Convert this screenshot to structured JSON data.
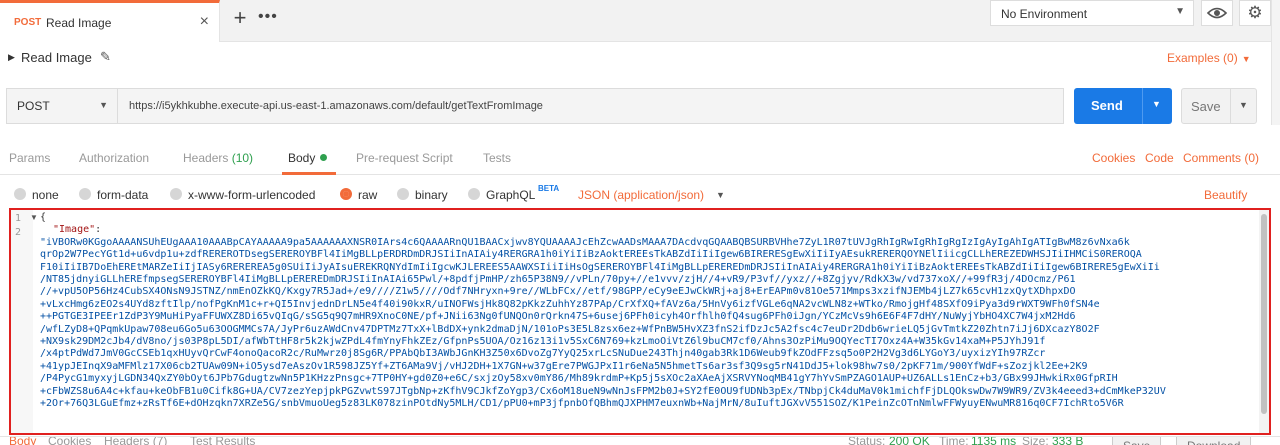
{
  "tabs": {
    "active": {
      "method": "POST",
      "name": "Read Image",
      "close": "×"
    },
    "add": "+",
    "more": "•••"
  },
  "environment": {
    "selected": "No Environment"
  },
  "request": {
    "name": "Read Image",
    "examples_label": "Examples (0)",
    "method": "POST",
    "url": "https://i5ykhkubhe.execute-api.us-east-1.amazonaws.com/default/getTextFromImage",
    "send_label": "Send",
    "save_label": "Save"
  },
  "request_tabs": [
    {
      "label": "Params",
      "count": ""
    },
    {
      "label": "Authorization",
      "count": ""
    },
    {
      "label": "Headers",
      "count": "(10)"
    },
    {
      "label": "Body",
      "count": ""
    },
    {
      "label": "Pre-request Script",
      "count": ""
    },
    {
      "label": "Tests",
      "count": ""
    }
  ],
  "right_links": [
    "Cookies",
    "Code",
    "Comments (0)"
  ],
  "body_types": [
    {
      "label": "none",
      "selected": false
    },
    {
      "label": "form-data",
      "selected": false
    },
    {
      "label": "x-www-form-urlencoded",
      "selected": false
    },
    {
      "label": "raw",
      "selected": true
    },
    {
      "label": "binary",
      "selected": false
    },
    {
      "label": "GraphQL",
      "selected": false
    }
  ],
  "beta_label": "BETA",
  "raw_format": "JSON (application/json)",
  "beautify_label": "Beautify",
  "editor": {
    "line_numbers": [
      "1",
      "2"
    ],
    "open_brace": "{",
    "key": "\"Image\"",
    "colon": ":",
    "value_lines": [
      "\"iVBORw0KGgoAAAANSUhEUgAAA10AAABpCAYAAAAA9pa5AAAAAAXNSR0IArs4c6QAAAARnQU1BAACxjwv8YQUAAAAJcEhZcwAADsMAAA7DAcdvqGQAABQBSURBVHhe7ZyL1R07tUVJgRhIgRwIgRhIgRgIzIgAyIgAhIgATIgBwM8z6vNxa6k",
      "qrOp2W7PecYGt1d+u6vdp1u+zdfREREROTDsegSEREROYBFl4IiMgBLLpERDRDmDRJSIiInAIAiy4RERGRA1h0iYiIiBzAoktEREEsTkABZdIiIiIgew6BIRERESgEwXiIiIyAEsukRERERQOYNElIiicgCLLhEREZEDWHSJIiIHMCiS0REROQA",
      "F10iIiIB7DoEhEREtMARZeIiIjIASy6REREREA5g0SUiIiJyAIsuEREKRQNYdImIiIgcwKJLEREES5AAWXSIiiIiHsOgSEREROYBFl4IiMgBLLpEREREDmDRJSIiInAIAiy4RERGRA1h0iYiIiBzAoktEREEsTkABZdIiIiIgew6BIRERE5gEwXiIi",
      "/NT85jdnyiGLLhEREfmpsegSEREROYBFl4IiMgBLLpEREREDmDRJSIiInAIAi65Pwl/+8pdfjPmHP/zh65P38N9//vPLn/70py+//e1vvv/zjH//4+vR9/P3vf//yxz//+8Zgjyv/RdkX3w/vd737xoX//+99fR3j/4DOcmz/P61",
      "//+vpU5OP56Hz4CubSX4ONsN9JSTNZ/nmEnOZkKQ/Kxgy7R5Jad+/e9////Z1w5////Odf7NHryxn+9re//WLbFCx//etf/98GPP/eCy9eEJwCkWRj+aj8+ErEAPm0v81Oe571Mmps3xzifNJEMb4jLZ7k65cvH1zxQytXDhpxDO",
      "+vLxcHmg6zEO2s4UYd8zftIlp/nofPgKnM1c+r+QI5InvjednDrLN5e4f40i90kxR/uINOFWsjHk8Q82pKkzZuhhYz87PAp/CrXfXQ+fAVz6a/5HnVy6izfVGLe6qNA2vcWLN8z+WTko/RmojgHf48SXfO9iPya3d9rWXT9WFh0fSN4e",
      "++PGTGE3IPEEr1ZdP3Y9MuHiPyaFFUWXZ8Di65vQIqG/sSG5q9Q7mHR9XnoC0NE/pf+JNii63Ng0fUNQOn0rQrkn47S+6usej6PFh0icyh4Orfhlh0fQ4sug6PFh0iJgn/YCzMcVs9h6E6F4F7dHY/NuWyjYbHO4XC7W4jxM2Hd6",
      "/wfLZyD8+QPqmkUpaw708eu6Go5u63OOGMMCs7A/JyPr6uzAWdCnv47DPTMz7TxX+lBdDX+ynk2dmaDjN/101oPs3E5L8zsx6ez+WfPnBW5HvXZ3fnS2ifDzJc5A2fsc4c7euDr2Ddb6wrieLQ5jGvTmtkZ20Zhtn7iJj6DXcazY8O2F",
      "+NX9sk29DM2cJb4/dV8no/js03P8pL5DI/afWbTtHF8r5k2kjwZPdL4fmYnyFhkZEz/GfpnPs5UOA/Oz16z13i1v5SxC6N769+kzLmoOiVtZ6l9buCM7cf0/Ahns3OzPiMu9OQYecTI7Oxz4A+W35kGv14xaM+P5JYhJ91f",
      "/x4ptPdWd7JmV0GcCSEb1qxHUyvQrCwF4onoQacoR2c/RuMwrz0j8Sg6R/PPAbQbI3AWbJGnKH3Z50x6DvoZg7YyQ25xrLcSNuDue243Thjn40gab3Rk1D6Weub9fkZOdFFzsq5o0P2H2Vg3d6LYGoY3/uyxizYIh97RZcr",
      "+41ypJEInqX9aMFMlz17X06cb2TUAw09N+iO5ysd7eAszOv1R598JZ5Yf+ZT6AMa9Vj/vHJ2DH+1X7GN+w37gEre7PWGJPxI1r6eNa5N5hmetTs6ar3sf3Q9sg5rN41DdJ5+lok98hw7s0/2pKF71m/900YfWdF+sZozjkl2Ee+2K9",
      "/P4PycG1myxyjLGDN34QxZY0bOyt6JPb7GdugtzwNn5P1KHzzPnsgc+7TP0HY+gd0Z0+e6C/sxjzOy58xv0mY86/Mh89krdmP+Kp5j5sXOc2aXAeAjXSRVYNoqMB41gY7hYvSmPZAGO1AUP+UZ6ALLs1EnCz+b3/GBx99JHwkiRx0GfpRIH",
      "+cFbWZS8u6A4c+kfau+keObFB1u0Cifk8G+UA/CV7zezYepjpkPGZvwtS97JTgbNp+zKfhV9CJkfZoYgp3/Cx6oM18ueN9wNnJsFPM2b0J+SY2fE0OU9fUDNb3pEx/TNbpjCk4duMaV0k1michfFjDLQOkswDw7W9WR9/ZV3k4eeed3+dCmMkeP32UV",
      "+2Or+76Q3LGuEfmz+zRsTf6E+dOHzqkn7XRZe5G/snbVmuoUeg5z83LK078zinPOtdNy5MLH/CD1/pPU0+mP3jfpnbOfQBhmQJXPHM7euxnWb+NajMrN/8uIuftJGXvV551SOZ/K1PeinZcOTnNmlwFFWyuyENwuMR816q0CF7IchRto5V6R"
    ]
  },
  "response_bar": {
    "tabs": [
      "Body",
      "Cookies",
      "Headers (7)",
      "Test Results"
    ],
    "status_label": "Status:",
    "status": "200 OK",
    "time_label": "Time:",
    "time": "1135 ms",
    "size_label": "Size:",
    "size": "333 B",
    "save_label": "Save",
    "download_label": "Download"
  },
  "colors": {
    "accent": "#f26b3a",
    "send": "#1a7ae6",
    "highlight_border": "#e0201f",
    "success": "#2fa04f"
  }
}
